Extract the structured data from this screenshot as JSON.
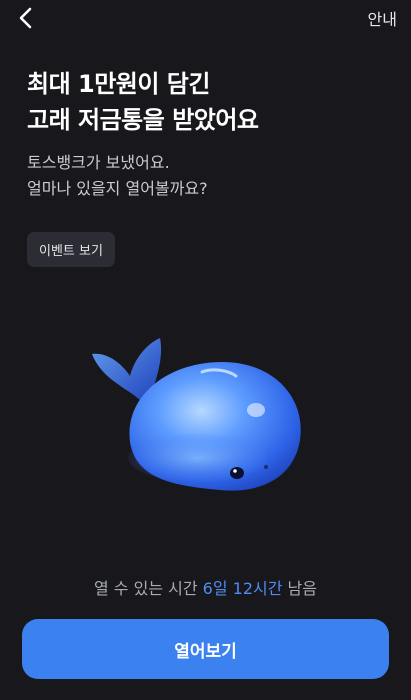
{
  "header": {
    "back_icon": "chevron-left-icon",
    "info_label": "안내"
  },
  "headline": {
    "line1": "최대 1만원이 담긴",
    "line2": "고래 저금통을 받았어요"
  },
  "subtext": {
    "line1": "토스뱅크가 보냈어요.",
    "line2": "얼마나 있을지 열어볼까요?"
  },
  "event_chip": {
    "label": "이벤트 보기"
  },
  "illustration": {
    "icon": "whale-piggy-bank-icon"
  },
  "timer": {
    "prefix": "열 수 있는 시간",
    "remaining": "6일 12시간",
    "suffix": "남음"
  },
  "cta": {
    "label": "열어보기"
  },
  "colors": {
    "background": "#17171c",
    "accent": "#4f8cf0",
    "button": "#3b82f0"
  }
}
